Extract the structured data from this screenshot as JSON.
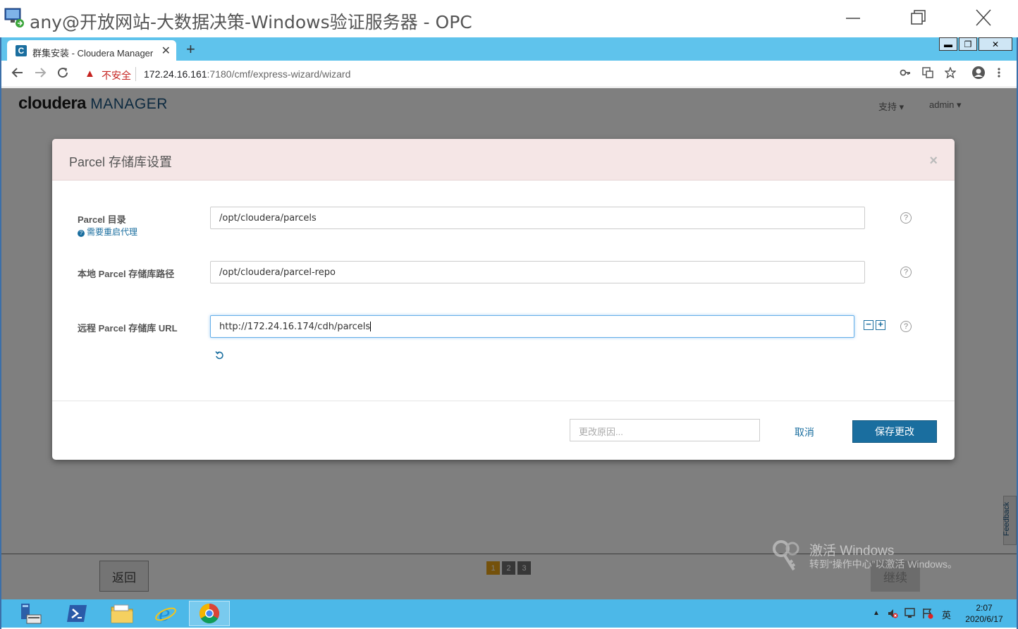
{
  "rdp": {
    "title": "any@开放网站-大数据决策-Windows验证服务器 - OPC"
  },
  "browser": {
    "tab_title": "群集安装 - Cloudera Manager",
    "tab_favicon_letter": "C",
    "insecure_label": "不安全",
    "url_host": "172.24.16.161",
    "url_path": ":7180/cmf/express-wizard/wizard",
    "inner_min": "▬",
    "inner_restore": "❐",
    "inner_close": "✕"
  },
  "app": {
    "logo_brand": "cloudera",
    "logo_product": "MANAGER",
    "nav_support": "支持",
    "nav_user": "admin",
    "back_button": "返回",
    "next_button": "继续",
    "steps": [
      "1",
      "2",
      "3"
    ],
    "active_step": 0,
    "feedback": "Feedback"
  },
  "modal": {
    "title": "Parcel 存储库设置",
    "close": "×",
    "fields": [
      {
        "label": "Parcel 目录",
        "value": "/opt/cloudera/parcels"
      },
      {
        "label": "本地 Parcel 存储库路径",
        "value": "/opt/cloudera/parcel-repo"
      },
      {
        "label": "远程 Parcel 存储库 URL",
        "value": "http://172.24.16.174/cdh/parcels"
      }
    ],
    "restart_note": "需要重启代理",
    "help_glyph": "?",
    "reason_placeholder": "更改原因...",
    "cancel_label": "取消",
    "save_label": "保存更改"
  },
  "watermark": {
    "title": "激活 Windows",
    "subtitle": "转到“操作中心”以激活 Windows。"
  },
  "taskbar": {
    "ime": "英",
    "time": "2:07",
    "date": "2020/6/17"
  },
  "colors": {
    "accent": "#1a6e9f",
    "tabstrip": "#5fc3ec",
    "taskbar": "#4cb8e8",
    "modal_header": "#f5e6e6",
    "step_active": "#e8a317"
  }
}
